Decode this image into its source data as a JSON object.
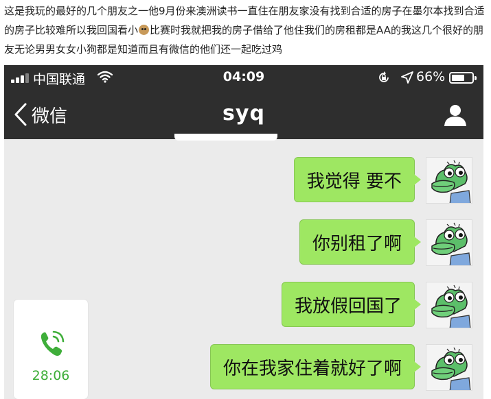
{
  "post": {
    "text_before_emoji": "这是我玩的最好的几个朋友之一他9月份来澳洲读书一直住在朋友家没有找到合适的房子在墨尔本找到合适的房子比较难所以我回国看小",
    "emoji": "dog-face-emoji",
    "text_after_emoji": "比赛时我就把我的房子借给了他住我们的房租都是AA的我这几个很好的朋友无论男男女女小狗都是知道而且有微信的他们还一起吃过鸡"
  },
  "status_bar": {
    "carrier": "中国联通",
    "time": "04:09",
    "battery_percent": "66%",
    "battery_level": 0.66,
    "icons": [
      "signal-icon",
      "wifi-icon",
      "orientation-lock-icon",
      "location-arrow-icon",
      "battery-icon"
    ]
  },
  "nav": {
    "back_label": "微信",
    "title": "syq",
    "icons": [
      "chevron-left-icon",
      "profile-icon"
    ]
  },
  "messages": [
    {
      "side": "right",
      "text": "我觉得 要不"
    },
    {
      "side": "right",
      "text": "你别租了啊"
    },
    {
      "side": "right",
      "text": "我放假回国了"
    },
    {
      "side": "right",
      "text": "你在我家住着就好了啊"
    }
  ],
  "call_record": {
    "icon": "phone-call-icon",
    "duration": "28:06"
  },
  "colors": {
    "bar_bg": "#2e2e2e",
    "chat_bg": "#ebebeb",
    "bubble_green": "#9ee762",
    "call_green": "#3fae3a"
  }
}
